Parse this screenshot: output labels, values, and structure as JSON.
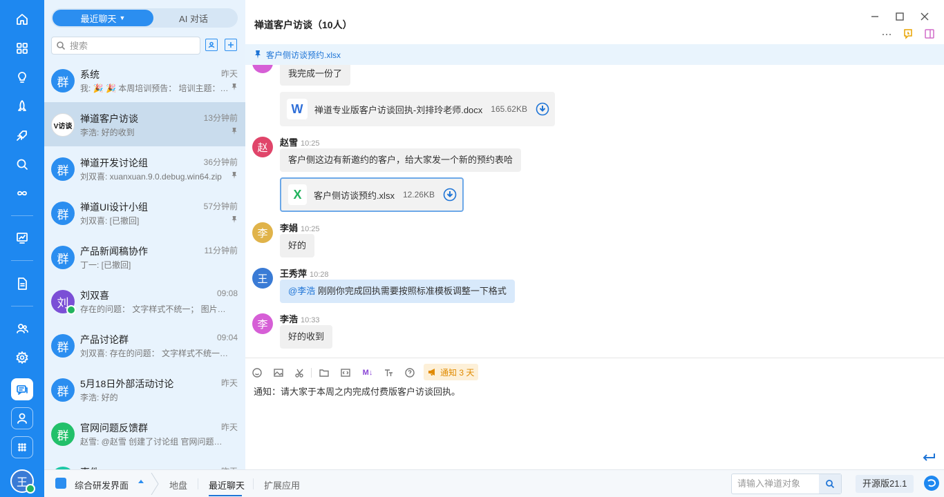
{
  "colors": {
    "accent": "#1e88f0",
    "online": "#22b35e",
    "notice": "#e08a00"
  },
  "rail": {
    "items": [
      "home-icon",
      "grid-icon",
      "bulb-icon",
      "rocket-icon",
      "plane-icon",
      "search-icon",
      "infinity-icon",
      "dashboard-icon",
      "document-icon",
      "team-icon",
      "settings-icon",
      "chat-icon",
      "user-icon",
      "apps-icon"
    ],
    "me": "王"
  },
  "list": {
    "tab_recent": "最近聊天",
    "tab_ai": "AI 对话",
    "search_placeholder": "搜索",
    "chats": [
      {
        "avatar": "群",
        "color": "#2b8ef0",
        "name": "系统",
        "time": "昨天",
        "preview": "我: 🎉 🎉 本周培训预告： 培训主题：…",
        "pinned": true
      },
      {
        "avatar": "V访谈",
        "color": "#ffffff",
        "name": "禅道客户访谈",
        "time": "13分钟前",
        "preview": "李浩: 好的收到",
        "pinned": true,
        "selected": true
      },
      {
        "avatar": "群",
        "color": "#2b8ef0",
        "name": "禅道开发讨论组",
        "time": "36分钟前",
        "preview": "刘双喜: xuanxuan.9.0.debug.win64.zip",
        "pinned": true
      },
      {
        "avatar": "群",
        "color": "#2b8ef0",
        "name": "禅道UI设计小组",
        "time": "57分钟前",
        "preview": "刘双喜: [已撤回]",
        "pinned": true
      },
      {
        "avatar": "群",
        "color": "#2b8ef0",
        "name": "产品新闻稿协作",
        "time": "11分钟前",
        "preview": "丁一: [已撤回]",
        "pinned": false
      },
      {
        "avatar": "刘",
        "color": "#7b4fd6",
        "name": "刘双喜",
        "time": "09:08",
        "preview": "存在的问题： 文字样式不统一； 图片大…",
        "pinned": false,
        "online": true
      },
      {
        "avatar": "群",
        "color": "#2b8ef0",
        "name": "产品讨论群",
        "time": "09:04",
        "preview": "刘双喜: 存在的问题： 文字样式不统一；…",
        "pinned": false
      },
      {
        "avatar": "群",
        "color": "#2b8ef0",
        "name": "5月18日外部活动讨论",
        "time": "昨天",
        "preview": "李浩: 好的",
        "pinned": false
      },
      {
        "avatar": "群",
        "color": "#22c06a",
        "name": "官网问题反馈群",
        "time": "昨天",
        "preview": "赵雪: @赵雪 创建了讨论组 官网问题反…",
        "pinned": false
      },
      {
        "avatar": "群",
        "color": "#1bc7a5",
        "name": "事件",
        "time": "昨天",
        "preview": "",
        "pinned": false
      }
    ]
  },
  "main": {
    "title": "禅道客户访谈（10人）",
    "pinned_file": "客户侧访谈预约.xlsx",
    "messages": {
      "m0_text": "我完成一份了",
      "m0_file_name": "禅道专业版客户访谈回执-刘排玲老师.docx",
      "m0_file_size": "165.62KB",
      "m0_file_type": "W",
      "m1_avatar": "赵",
      "m1_name": "赵雪",
      "m1_time": "10:25",
      "m1_text": "客户侧这边有新邀约的客户，给大家发一个新的预约表哈",
      "m1_file_name": "客户侧访谈预约.xlsx",
      "m1_file_size": "12.26KB",
      "m1_file_type": "X",
      "m2_avatar": "李",
      "m2_name": "李娟",
      "m2_time": "10:25",
      "m2_text": "好的",
      "m3_avatar": "王",
      "m3_name": "王秀萍",
      "m3_time": "10:28",
      "m3_mention": "@李浩",
      "m3_text": " 刚刚你完成回执需要按照标准模板调整一下格式",
      "m4_avatar": "李",
      "m4_name": "李浩",
      "m4_time": "10:33",
      "m4_text": "好的收到"
    },
    "composer": {
      "notice_label": "通知 3 天",
      "md_label": "M↓",
      "draft": "通知：请大家于本周之内完成付费版客户访谈回执。"
    }
  },
  "bottom": {
    "workspace": "综合研发界面",
    "tab_map": "地盘",
    "tab_recent": "最近聊天",
    "tab_ext": "扩展应用",
    "search_placeholder": "请输入禅道对象",
    "version": "开源版21.1"
  }
}
